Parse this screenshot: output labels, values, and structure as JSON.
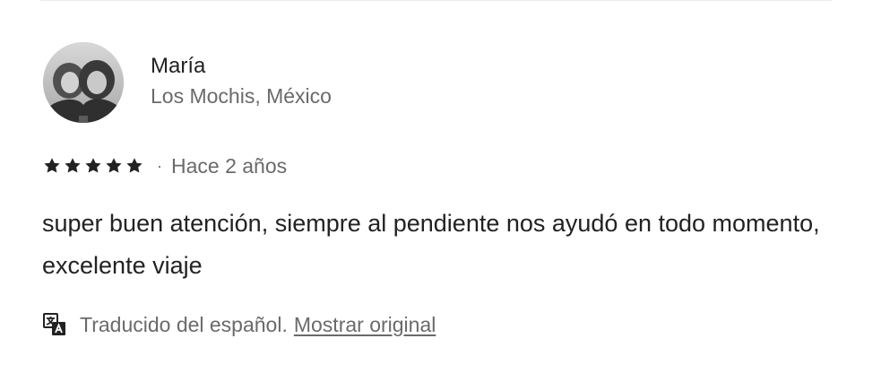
{
  "reviewer": {
    "name": "María",
    "location": "Los Mochis, México",
    "avatar_icon": "reviewer-photo"
  },
  "rating": {
    "stars": 5,
    "max_stars": 5,
    "separator": "·",
    "age": "Hace 2 años"
  },
  "review": {
    "text": "super buen atención, siempre al pendiente nos ayudó en todo momento, excelente viaje"
  },
  "translation": {
    "icon": "translate-icon",
    "text": "Traducido del español.",
    "show_original_link": "Mostrar original"
  },
  "colors": {
    "primary_text": "#222222",
    "secondary_text": "#6a6a6a",
    "divider": "#ebebeb"
  }
}
